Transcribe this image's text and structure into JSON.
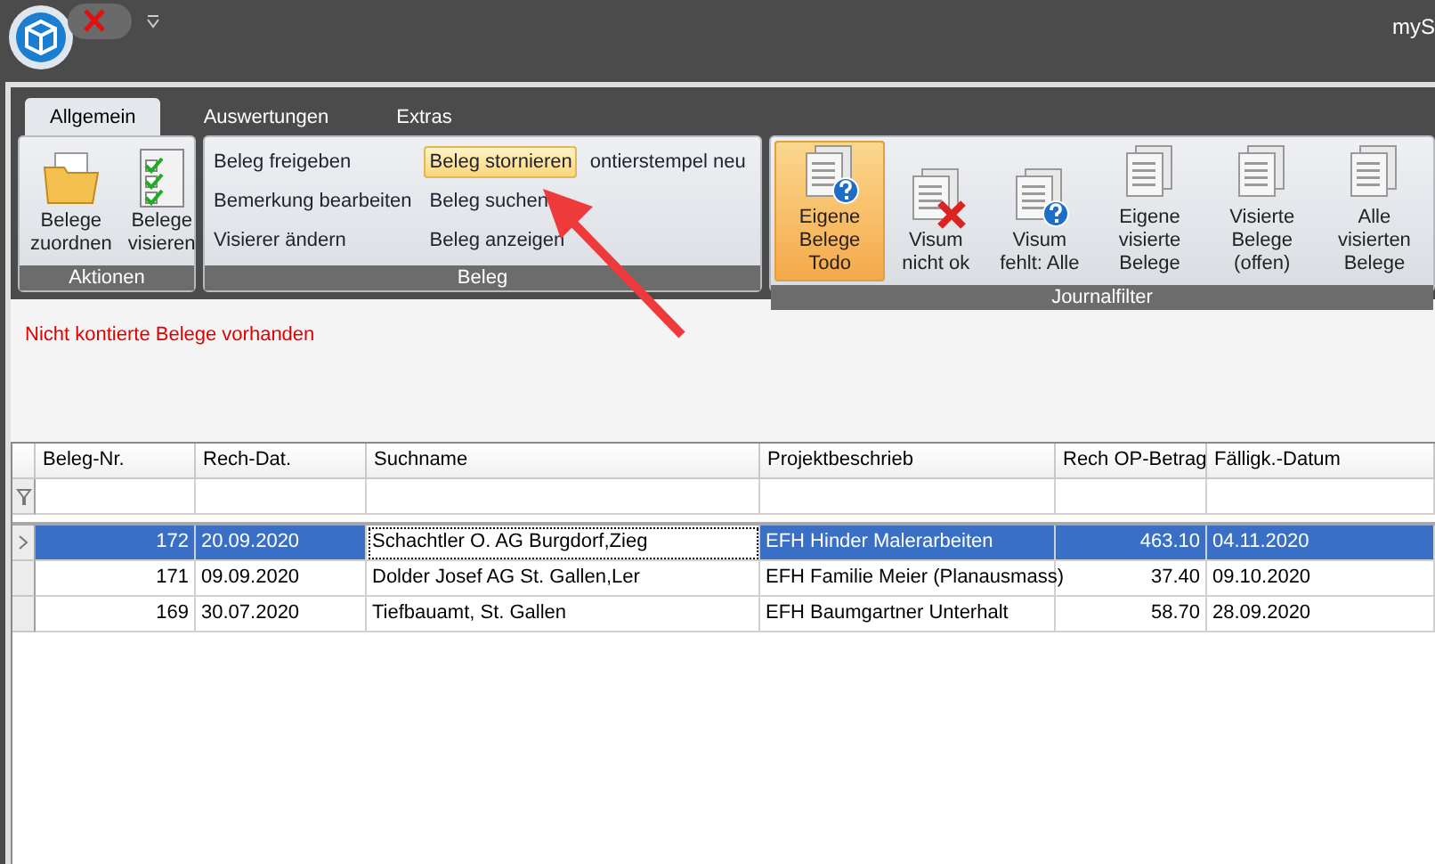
{
  "app": {
    "title": "myS"
  },
  "ribbon": {
    "tabs": [
      {
        "label": "Allgemein",
        "selected": true
      },
      {
        "label": "Auswertungen",
        "selected": false
      },
      {
        "label": "Extras",
        "selected": false
      }
    ],
    "groups": [
      {
        "kind": "large",
        "title": "Aktionen",
        "buttons": [
          {
            "label": "Belege zuordnen",
            "kind": "folder",
            "selected": false
          },
          {
            "label": "Belege visieren",
            "kind": "checklist",
            "selected": false
          }
        ]
      },
      {
        "kind": "small",
        "title": "Beleg",
        "columns": [
          [
            {
              "label": "Beleg freigeben",
              "highlighted": false
            },
            {
              "label": "Bemerkung bearbeiten",
              "highlighted": false
            },
            {
              "label": "Visierer ändern",
              "highlighted": false
            }
          ],
          [
            {
              "label": "Beleg stornieren",
              "highlighted": true
            },
            {
              "label": "Beleg suchen",
              "highlighted": false
            },
            {
              "label": "Beleg anzeigen",
              "highlighted": false
            }
          ],
          [
            {
              "label": "ontierstempel neu",
              "highlighted": false
            }
          ]
        ]
      },
      {
        "kind": "large",
        "title": "Journalfilter",
        "buttons": [
          {
            "label": "Eigene Belege Todo",
            "kind": "pending",
            "selected": true
          },
          {
            "label": "Visum nicht ok",
            "kind": "rejected",
            "selected": false
          },
          {
            "label": "Visum fehlt: Alle",
            "kind": "pending",
            "selected": false
          },
          {
            "label": "Eigene visierte Belege",
            "kind": "documents",
            "selected": false
          },
          {
            "label": "Visierte Belege (offen)",
            "kind": "documents",
            "selected": false
          },
          {
            "label": "Alle visierten Belege",
            "kind": "documents",
            "selected": false
          }
        ]
      }
    ]
  },
  "message": "Nicht kontierte Belege vorhanden",
  "grid": {
    "columns": [
      {
        "label": "Beleg-Nr.",
        "kind": "number",
        "current": false
      },
      {
        "label": "Rech-Dat.",
        "kind": "text",
        "current": false
      },
      {
        "label": "Suchname",
        "kind": "text",
        "current": true
      },
      {
        "label": "Projektbeschrieb",
        "kind": "text",
        "current": false
      },
      {
        "label": "Rech OP-Betrag",
        "kind": "number",
        "current": false
      },
      {
        "label": "Fälligk.-Datum",
        "kind": "text",
        "current": false
      }
    ],
    "rows": [
      {
        "selected": true,
        "cells": [
          "172",
          "20.09.2020",
          "Schachtler O. AG Burgdorf,Zieg",
          "EFH Hinder Malerarbeiten",
          "463.10",
          "04.11.2020"
        ]
      },
      {
        "selected": false,
        "cells": [
          "171",
          "09.09.2020",
          "Dolder Josef AG St. Gallen,Ler",
          "EFH Familie Meier (Planausmass)",
          "37.40",
          "09.10.2020"
        ]
      },
      {
        "selected": false,
        "cells": [
          "169",
          "30.07.2020",
          "Tiefbauamt, St. Gallen",
          "EFH Baumgartner Unterhalt",
          "58.70",
          "28.09.2020"
        ]
      }
    ]
  }
}
